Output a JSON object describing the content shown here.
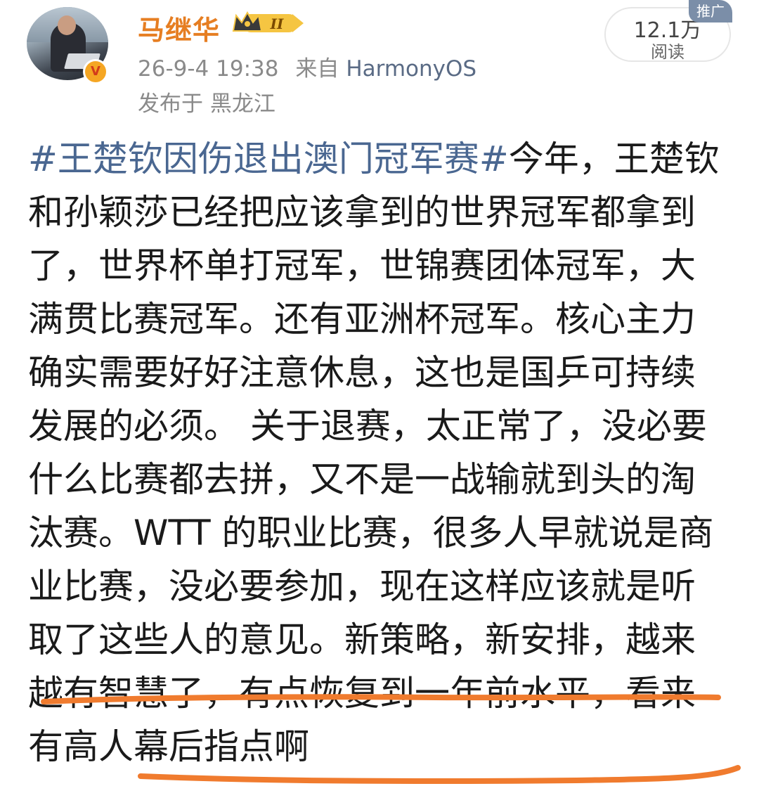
{
  "header": {
    "username": "马继华",
    "level_badge": "II",
    "timestamp": "26-9-4 19:38",
    "source_prefix": "来自",
    "source": "HarmonyOS",
    "location": "发布于 黑龙江",
    "read_count": "12.1万",
    "read_label": "阅读",
    "ad_tag": "推广",
    "verified_badge": "V"
  },
  "post": {
    "hashtag": "#王楚钦因伤退出澳门冠军赛#",
    "text": "今年，王楚钦和孙颖莎已经把应该拿到的世界冠军都拿到了，世界杯单打冠军，世锦赛团体冠军，大满贯比赛冠军。还有亚洲杯冠军。核心主力确实需要好好注意休息，这也是国乒可持续发展的必须。 关于退赛，太正常了，没必要什么比赛都去拼，又不是一战输就到头的淘汰赛。WTT 的职业比赛，很多人早就说是商业比赛，没必要参加，现在这样应该就是听取了这些人的意见。新策略，新安排，越来越有智慧了，有点恢复到一年前水平，看来有高人幕后指点啊"
  },
  "colors": {
    "username": "#e67e22",
    "hashtag": "#4a6791",
    "underline": "#f07b2e",
    "ad_tag_bg": "#7b8ea8"
  }
}
